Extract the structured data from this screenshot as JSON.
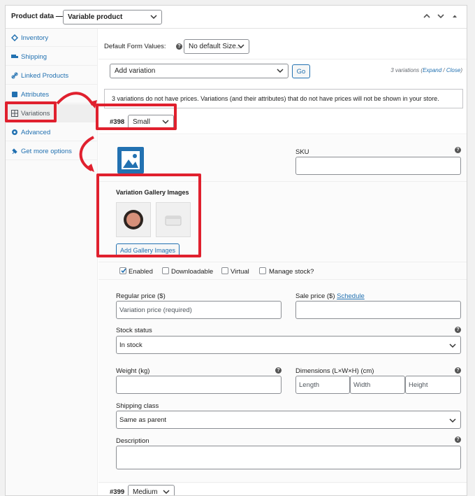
{
  "header": {
    "title": "Product data —",
    "product_type": "Variable product"
  },
  "sidebar": {
    "items": [
      {
        "label": "Inventory",
        "icon": "inventory-icon"
      },
      {
        "label": "Shipping",
        "icon": "truck-icon"
      },
      {
        "label": "Linked Products",
        "icon": "link-icon"
      },
      {
        "label": "Attributes",
        "icon": "attributes-icon"
      },
      {
        "label": "Variations",
        "icon": "grid-icon"
      },
      {
        "label": "Advanced",
        "icon": "gear-icon"
      },
      {
        "label": "Get more options",
        "icon": "plugin-icon"
      }
    ]
  },
  "main": {
    "default_form_label": "Default Form Values:",
    "default_size_value": "No default Size...",
    "add_variation_value": "Add variation",
    "go_label": "Go",
    "variations_count": "3 variations",
    "expand_label": "Expand",
    "close_label": "Close",
    "notice": "3 variations do not have prices. Variations (and their attributes) that do not have prices will not be shown in your store.",
    "variation1": {
      "id": "#398",
      "size": "Small"
    },
    "sku_label": "SKU",
    "gallery_title": "Variation Gallery Images",
    "add_gallery_label": "Add Gallery Images",
    "checkboxes": {
      "enabled": "Enabled",
      "downloadable": "Downloadable",
      "virtual": "Virtual",
      "manage_stock": "Manage stock?"
    },
    "regular_price_label": "Regular price ($)",
    "regular_price_placeholder": "Variation price (required)",
    "sale_price_label": "Sale price ($)",
    "schedule_label": "Schedule",
    "stock_status_label": "Stock status",
    "stock_status_value": "In stock",
    "weight_label": "Weight (kg)",
    "dimensions_label": "Dimensions (L×W×H) (cm)",
    "length_placeholder": "Length",
    "width_placeholder": "Width",
    "height_placeholder": "Height",
    "shipping_class_label": "Shipping class",
    "shipping_class_value": "Same as parent",
    "description_label": "Description",
    "variation2": {
      "id": "#399",
      "size": "Medium"
    }
  },
  "colors": {
    "accent": "#2271b1",
    "highlight": "#e0202e"
  }
}
